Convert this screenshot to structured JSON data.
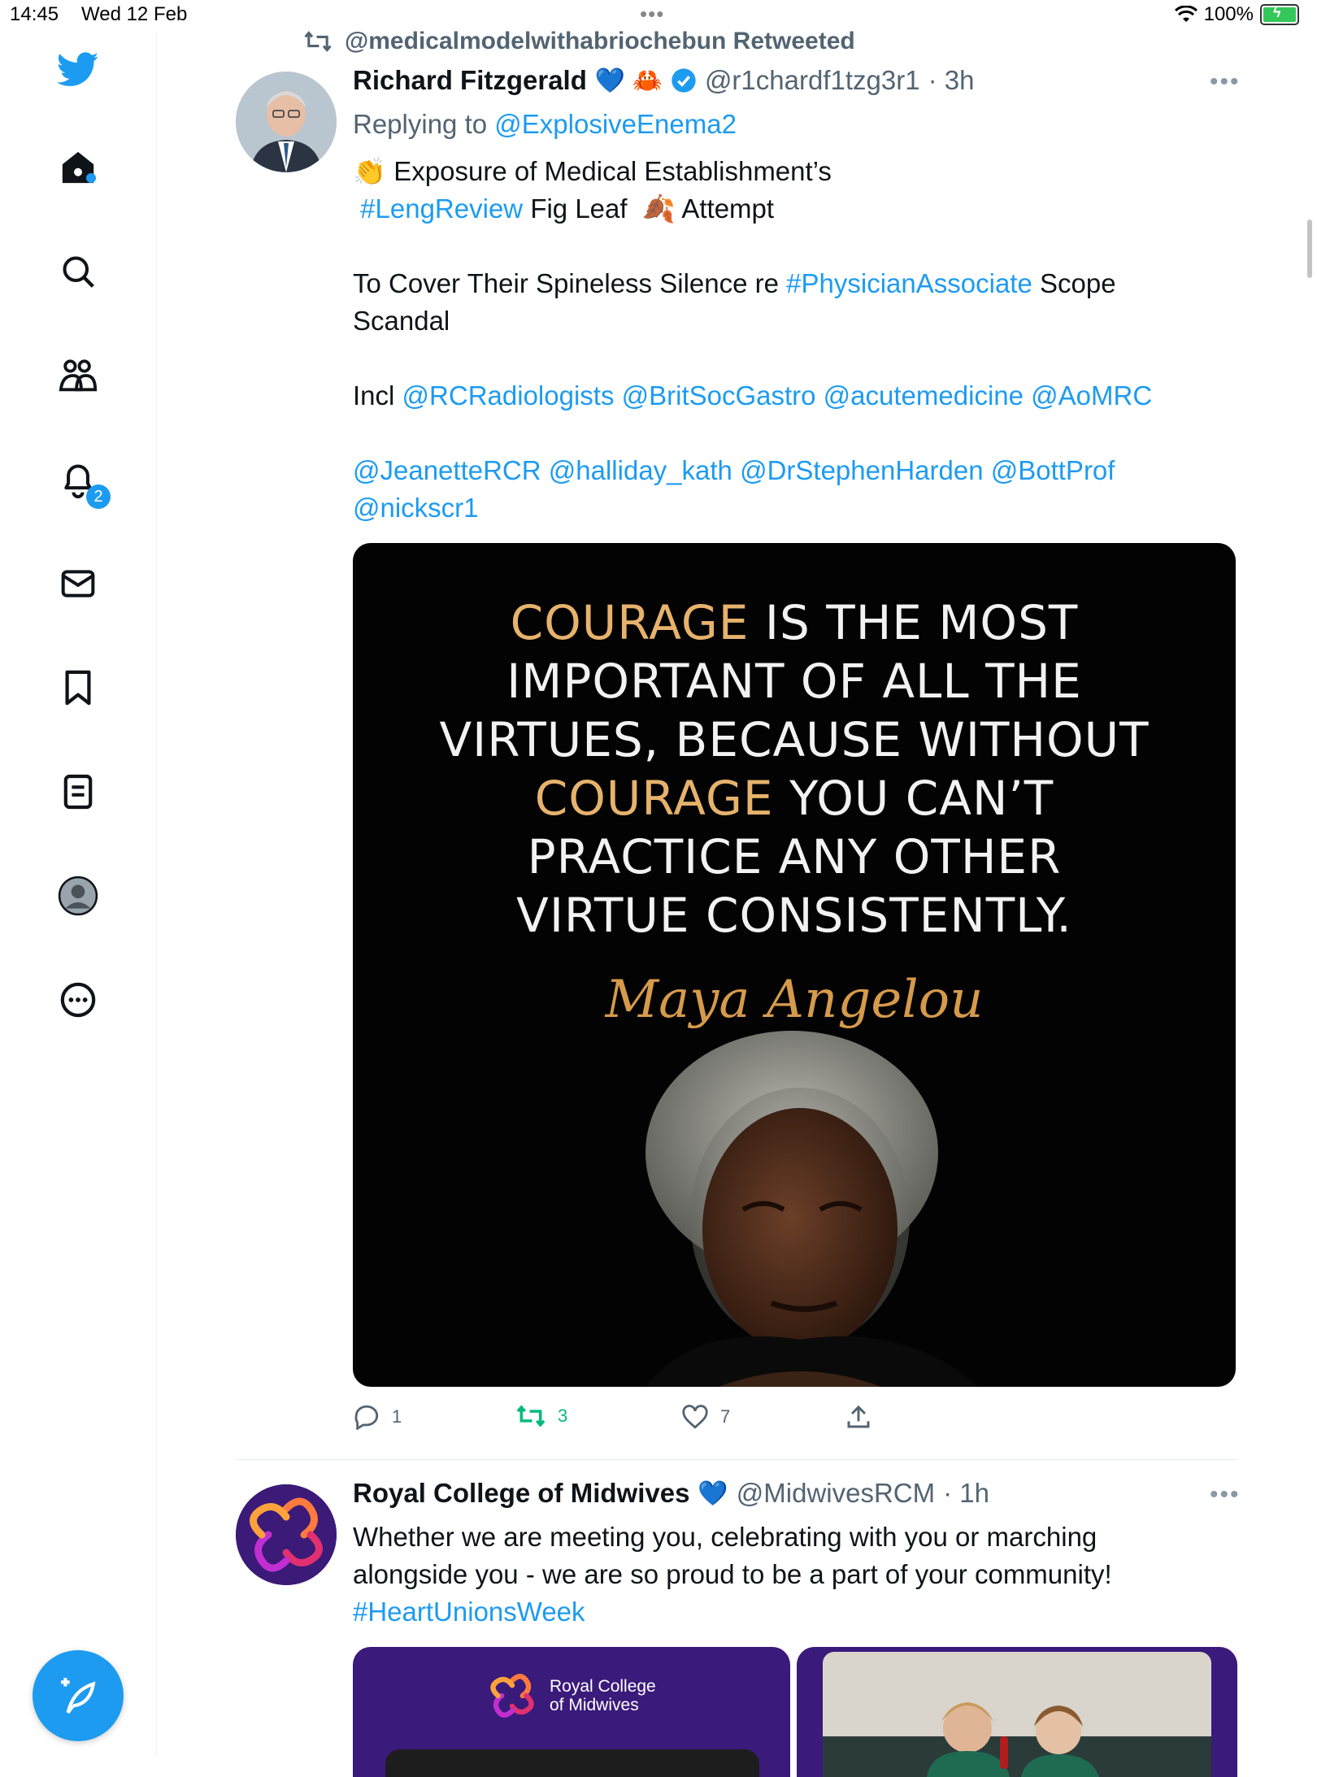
{
  "status_bar": {
    "time": "14:45",
    "date": "Wed 12 Feb",
    "battery": "100%"
  },
  "sidebar": {
    "notifications_badge": "2",
    "items": [
      "home-icon",
      "search-icon",
      "communities-icon",
      "notifications-icon",
      "messages-icon",
      "bookmarks-icon",
      "lists-icon",
      "profile-icon",
      "more-icon"
    ]
  },
  "colors": {
    "accent": "#1d9bf0",
    "retweet_green": "#00ba7c",
    "text": "#0f1419",
    "muted": "#536471"
  },
  "retweet_banner": {
    "text": "@medicalmodelwithabriochebun Retweeted"
  },
  "tweet1": {
    "name": "Richard Fitzgerald",
    "name_emoji": "💙 🦀",
    "handle": "@r1chardf1tzg3r1",
    "time": "· 3h",
    "reply_prefix": "Replying to",
    "reply_to": "@ExplosiveEnema2",
    "line1_emoji": "👏",
    "line1": "Exposure of Medical Establishment’s",
    "hashtag_leng": "#LengReview",
    "line2_rest": "Fig Leaf",
    "leaf_emoji": "🍂",
    "line2_end": "Attempt",
    "line3_a": "To Cover Their Spineless Silence re",
    "hashtag_pa": "#PhysicianAssociate",
    "line3_b": "Scope",
    "line3_c": "Scandal",
    "incl": "Incl",
    "mentions1": "@RCRadiologists @BritSocGastro @acutemedicine @AoMRC",
    "mentions2": "@JeanetteRCR @halliday_kath @DrStephenHarden @BottProf",
    "mentions3": "@nickscr1",
    "image": {
      "l1_gold": "COURAGE",
      "l1_rest": " IS THE MOST",
      "l2": "IMPORTANT OF ALL THE",
      "l3": "VIRTUES, BECAUSE WITHOUT",
      "l4_gold": "COURAGE",
      "l4_rest": " YOU CAN’T",
      "l5": "PRACTICE ANY OTHER",
      "l6": "VIRTUE CONSISTENTLY.",
      "signature": "Maya Angelou"
    },
    "replies": "1",
    "retweets": "3",
    "likes": "7"
  },
  "tweet2": {
    "name": "Royal College of Midwives",
    "name_emoji": "💙",
    "handle": "@MidwivesRCM",
    "time": "· 1h",
    "line1": "Whether we are meeting you, celebrating with you or marching",
    "line2": "alongside you - we are so proud to be a part of your community!",
    "hashtag": "#HeartUnionsWeek",
    "media_logo_text_1": "Royal College",
    "media_logo_text_2": "of Midwives"
  }
}
